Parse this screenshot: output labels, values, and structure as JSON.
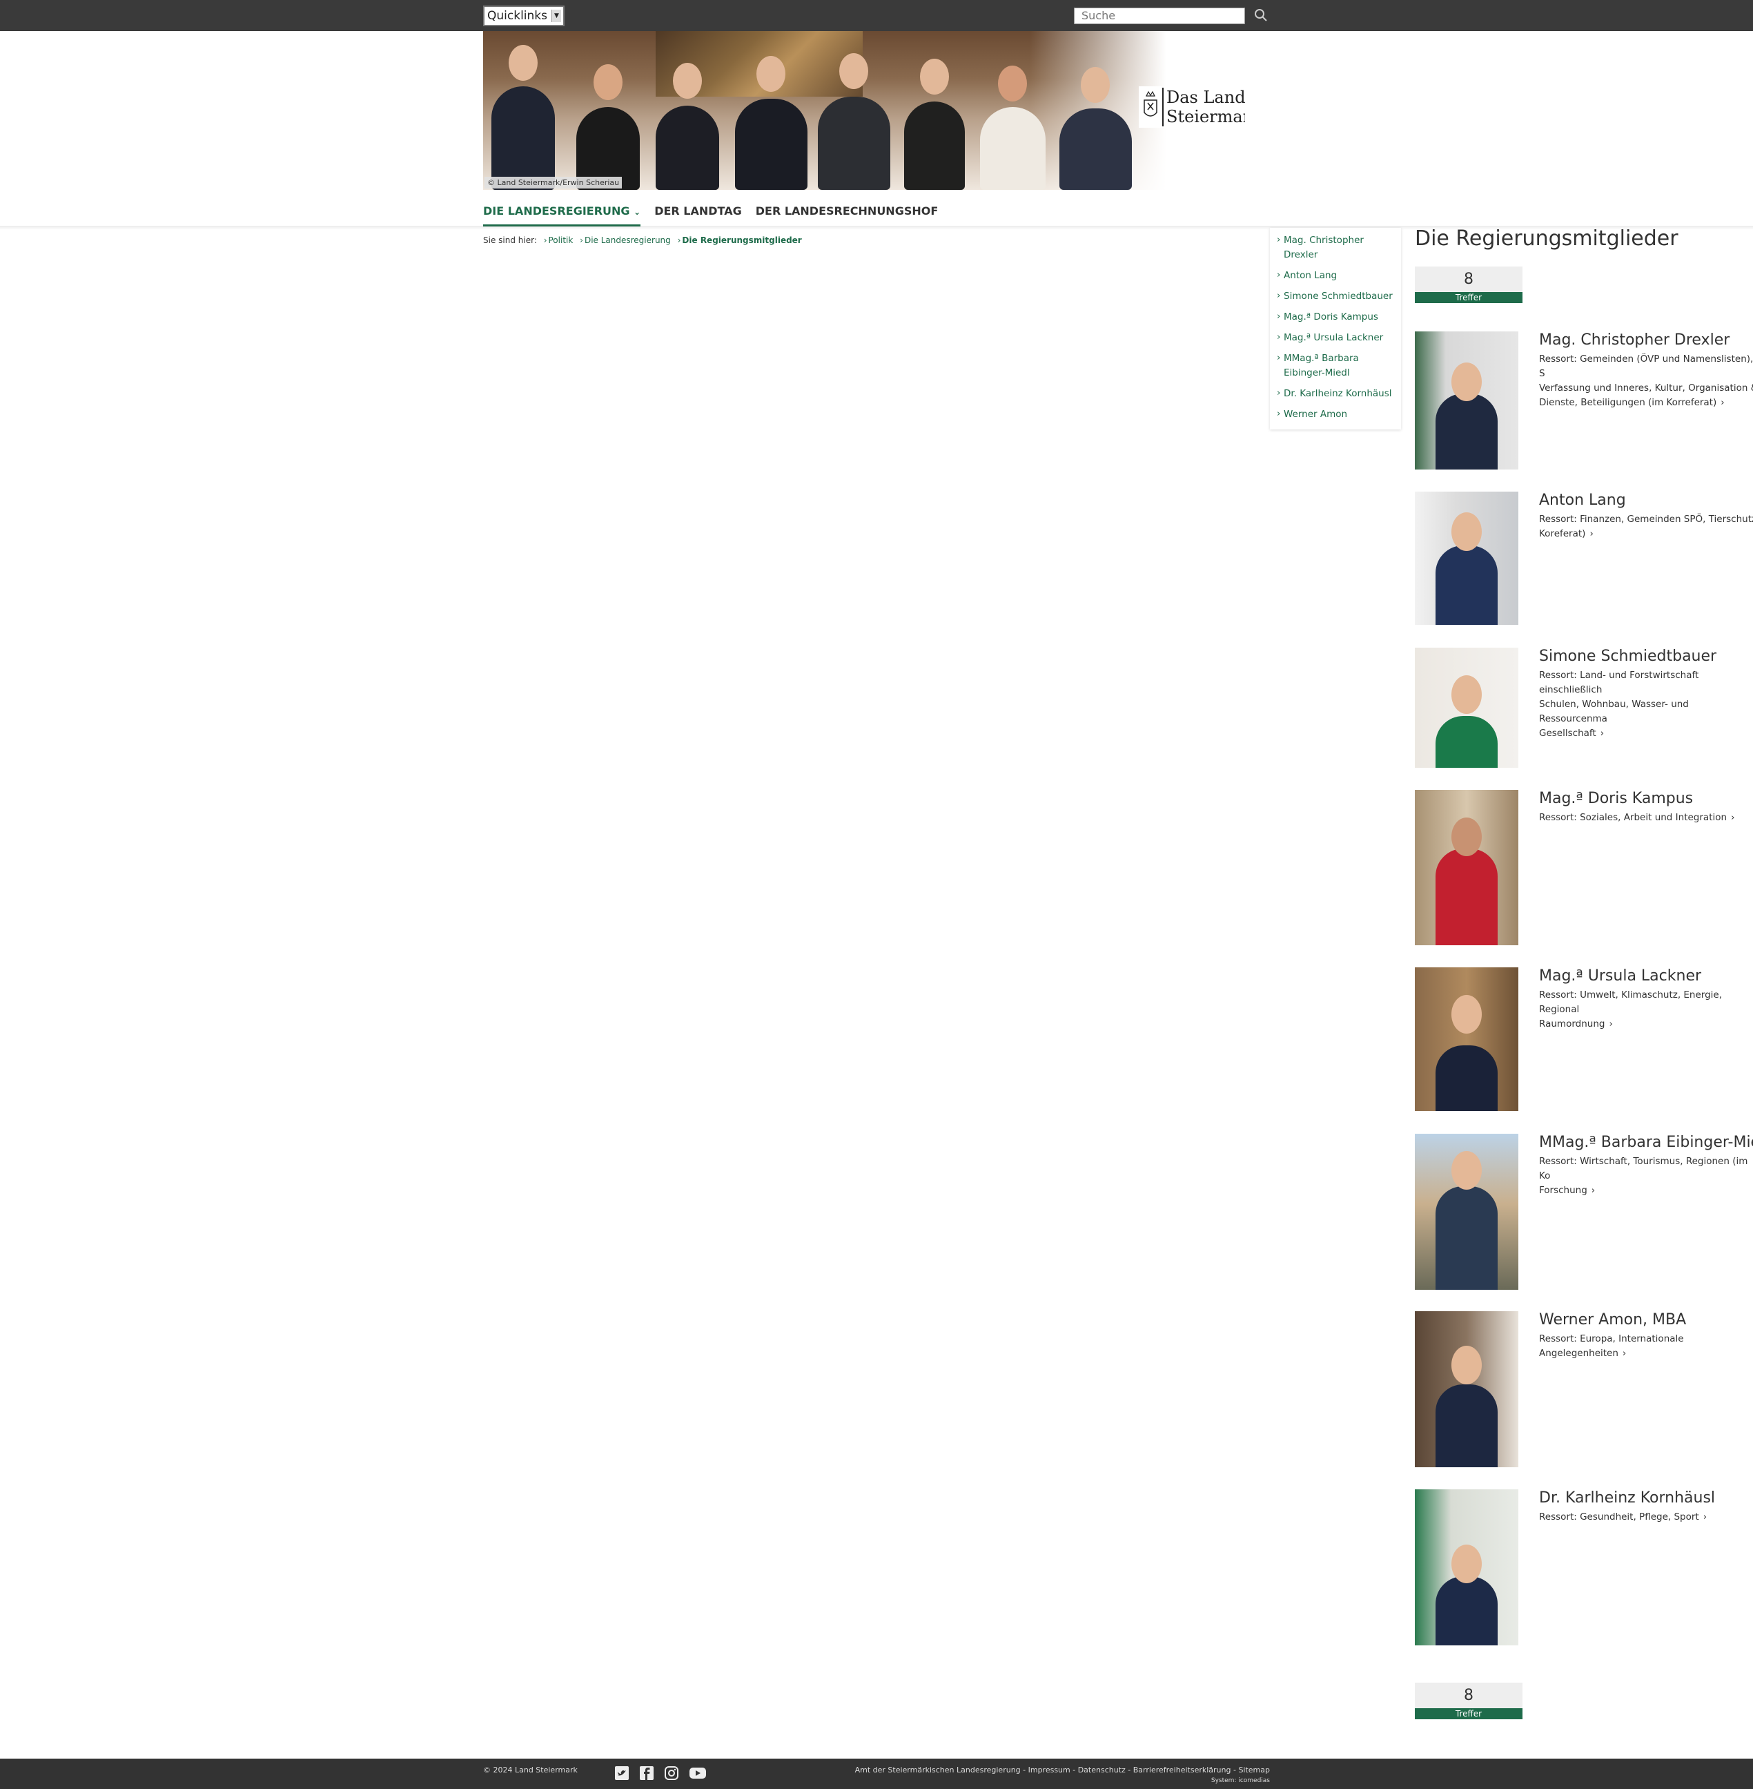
{
  "topbar": {
    "quicklinks": "Quicklinks",
    "search_placeholder": "Suche"
  },
  "header": {
    "photo_credit": "© Land Steiermark/Erwin Scheriau",
    "logo_line1": "Das Land",
    "logo_line2": "Steiermark"
  },
  "nav": [
    {
      "label": "DIE LANDESREGIERUNG"
    },
    {
      "label": "DER LANDTAG"
    },
    {
      "label": "DER LANDESRECHNUNGSHOF"
    }
  ],
  "breadcrumb": {
    "prefix": "Sie sind hier:",
    "items": [
      "Politik",
      "Die Landesregierung",
      "Die Regierungsmitglieder"
    ]
  },
  "sidemenu": [
    "Mag. Christopher Drexler",
    "Anton Lang",
    "Simone Schmiedtbauer",
    "Mag.ª Doris Kampus",
    "Mag.ª Ursula Lackner",
    "MMag.ª Barbara Eibinger-Miedl",
    "Dr. Karlheinz Kornhäusl",
    "Werner Amon"
  ],
  "main": {
    "title": "Die Regierungsmitglieder",
    "hits_count": "8",
    "hits_label": "Treffer",
    "members": [
      {
        "name": "Mag. Christopher Drexler",
        "desc": "Ressort: Gemeinden (ÖVP und Namenslisten), S\nVerfassung und Inneres, Kultur, Organisation &\nDienste, Beteiligungen (im Korreferat)"
      },
      {
        "name": "Anton Lang",
        "desc": "Ressort: Finanzen, Gemeinden SPÖ, Tierschutz,\nKoreferat)"
      },
      {
        "name": "Simone Schmiedtbauer",
        "desc": "Ressort: Land- und Forstwirtschaft einschließlich\nSchulen, Wohnbau, Wasser- und Ressourcenma\nGesellschaft"
      },
      {
        "name": "Mag.ª Doris Kampus",
        "desc": "Ressort: Soziales, Arbeit und Integration"
      },
      {
        "name": "Mag.ª Ursula Lackner",
        "desc": "Ressort: Umwelt, Klimaschutz, Energie, Regional\nRaumordnung"
      },
      {
        "name": "MMag.ª Barbara Eibinger-Mied",
        "desc": "Ressort: Wirtschaft, Tourismus, Regionen (im Ko\nForschung"
      },
      {
        "name": "Werner Amon, MBA",
        "desc": "Ressort: Europa, Internationale Angelegenheiten"
      },
      {
        "name": "Dr. Karlheinz Kornhäusl",
        "desc": "Ressort: Gesundheit, Pflege, Sport"
      }
    ]
  },
  "footer": {
    "copyright": "© 2024 Land Steiermark",
    "links": "Amt der Steiermärkischen Landesregierung - Impressum - Datenschutz - Barrierefreiheitserklärung - Sitemap",
    "system": "System: icomedias"
  },
  "colors": {
    "accent": "#1e6b4a",
    "topbar": "#3a3a3a",
    "footer": "#333333"
  }
}
